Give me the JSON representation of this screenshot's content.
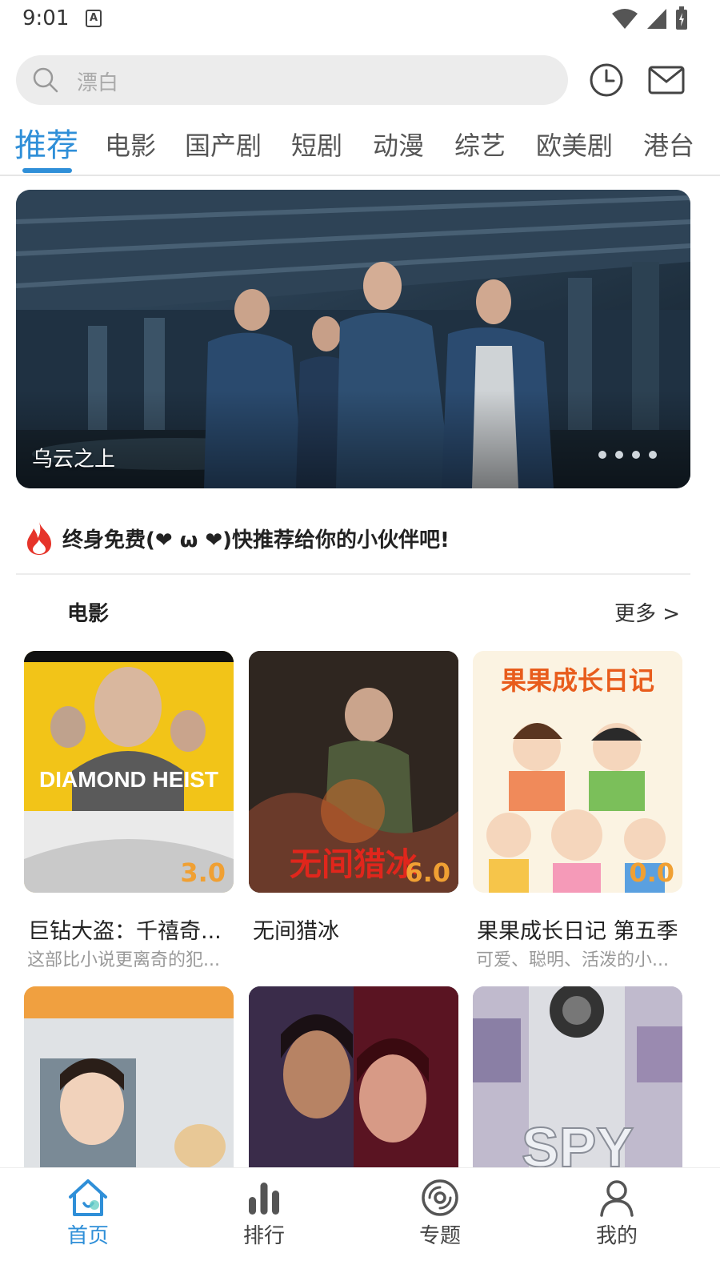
{
  "status_bar": {
    "time": "9:01",
    "notification_letter": "A"
  },
  "search": {
    "placeholder": "漂白"
  },
  "tabs": [
    {
      "label": "推荐",
      "active": true
    },
    {
      "label": "电影"
    },
    {
      "label": "国产剧"
    },
    {
      "label": "短剧"
    },
    {
      "label": "动漫"
    },
    {
      "label": "综艺"
    },
    {
      "label": "欧美剧"
    },
    {
      "label": "港台"
    }
  ],
  "banner": {
    "title": "乌云之上",
    "dots": 4
  },
  "notice": {
    "text": "终身免费(❤ ω ❤)快推荐给你的小伙伴吧!"
  },
  "section": {
    "title": "电影",
    "more": "更多 >"
  },
  "cards": [
    {
      "title": "巨钻大盗：千禧奇...",
      "desc": "这部比小说更离奇的犯...",
      "score": "3.0",
      "poster_text": "DIAMOND HEIST"
    },
    {
      "title": "无间猎冰",
      "desc": "",
      "score": "6.0",
      "poster_text": "无间猎冰"
    },
    {
      "title": "果果成长日记 第五季",
      "desc": "可爱、聪明、活泼的小...",
      "score": "0.0",
      "poster_text": "果果成长日记"
    },
    {
      "title": "",
      "desc": "",
      "score": "",
      "poster_text": ""
    },
    {
      "title": "",
      "desc": "",
      "score": "",
      "poster_text": ""
    },
    {
      "title": "",
      "desc": "",
      "score": "",
      "poster_text": "SPY"
    }
  ],
  "bottom_nav": [
    {
      "label": "首页",
      "icon": "home-icon",
      "active": true
    },
    {
      "label": "排行",
      "icon": "ranking-icon"
    },
    {
      "label": "专题",
      "icon": "disc-icon"
    },
    {
      "label": "我的",
      "icon": "user-icon"
    }
  ],
  "colors": {
    "accent": "#2f8fd8",
    "score": "#f0a033"
  }
}
